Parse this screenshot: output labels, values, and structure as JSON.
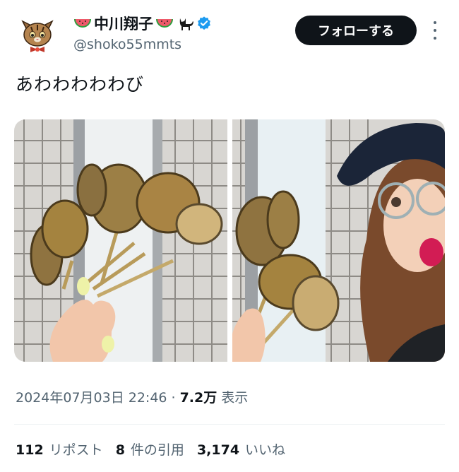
{
  "author": {
    "display_name": "中川翔子",
    "handle": "@shoko55mmts",
    "verified": true,
    "name_emojis": [
      "watermelon-icon",
      "watermelon-icon",
      "black-cat-icon"
    ]
  },
  "follow_button": {
    "label": "フォローする"
  },
  "more_menu": {
    "icon": "more-vertical-icon"
  },
  "tweet": {
    "text": "あわわわわわび"
  },
  "media": [
    {
      "icon": "photo-abalone-skewers"
    },
    {
      "icon": "photo-selfie-with-abalone"
    }
  ],
  "meta": {
    "timestamp": "2024年07月03日 22:46",
    "separator": "·",
    "views_count": "7.2万",
    "views_label": "表示"
  },
  "stats": {
    "reposts_count": "112",
    "reposts_label": "リポスト",
    "quotes_count": "8",
    "quotes_label": "件の引用",
    "likes_count": "3,174",
    "likes_label": "いいね"
  },
  "colors": {
    "verified_blue": "#1d9bf0",
    "text_secondary": "#536471",
    "button_dark": "#0f1419"
  }
}
